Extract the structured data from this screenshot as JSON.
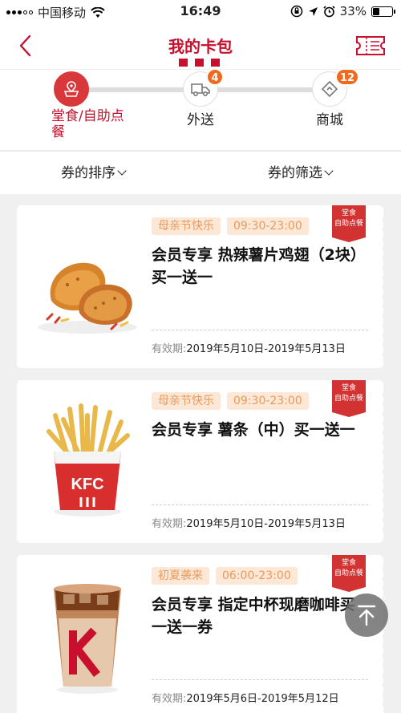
{
  "status_bar": {
    "carrier": "中国移动",
    "time": "16:49",
    "battery": "33%",
    "battery_level": 0.33
  },
  "header": {
    "title": "我的卡包",
    "back_icon": "chevron-left-icon",
    "ticket_icon": "ticket-icon"
  },
  "tabs": [
    {
      "label": "堂食/自助点餐",
      "icon": "store-pin-icon",
      "badge": ""
    },
    {
      "label": "外送",
      "icon": "delivery-truck-icon",
      "badge": "4"
    },
    {
      "label": "商城",
      "icon": "shop-tag-icon",
      "badge": "12"
    }
  ],
  "sort": {
    "sort_label": "券的排序",
    "filter_label": "券的筛选"
  },
  "coupons": [
    {
      "tags": [
        "母亲节快乐",
        "09:30-23:00"
      ],
      "corner": [
        "堂食",
        "自助点餐"
      ],
      "title": "会员专享 热辣薯片鸡翅（2块）买一送一",
      "validity_label": "有效期:",
      "validity": "2019年5月10日-2019年5月13日",
      "image": "fried-chicken-wings-image"
    },
    {
      "tags": [
        "母亲节快乐",
        "09:30-23:00"
      ],
      "corner": [
        "堂食",
        "自助点餐"
      ],
      "title": "会员专享 薯条（中）买一送一",
      "validity_label": "有效期:",
      "validity": "2019年5月10日-2019年5月13日",
      "image": "kfc-fries-image"
    },
    {
      "tags": [
        "初夏袭来",
        "06:00-23:00"
      ],
      "corner": [
        "堂食",
        "自助点餐"
      ],
      "title": "会员专享 指定中杯现磨咖啡买一送一券",
      "validity_label": "有效期:",
      "validity": "2019年5月6日-2019年5月12日",
      "image": "kcoffee-iced-latte-image"
    }
  ],
  "colors": {
    "brand_red": "#c8102e",
    "badge_orange": "#f06a1d",
    "tag_bg": "#fde8d8",
    "tag_text": "#e89a5a"
  }
}
